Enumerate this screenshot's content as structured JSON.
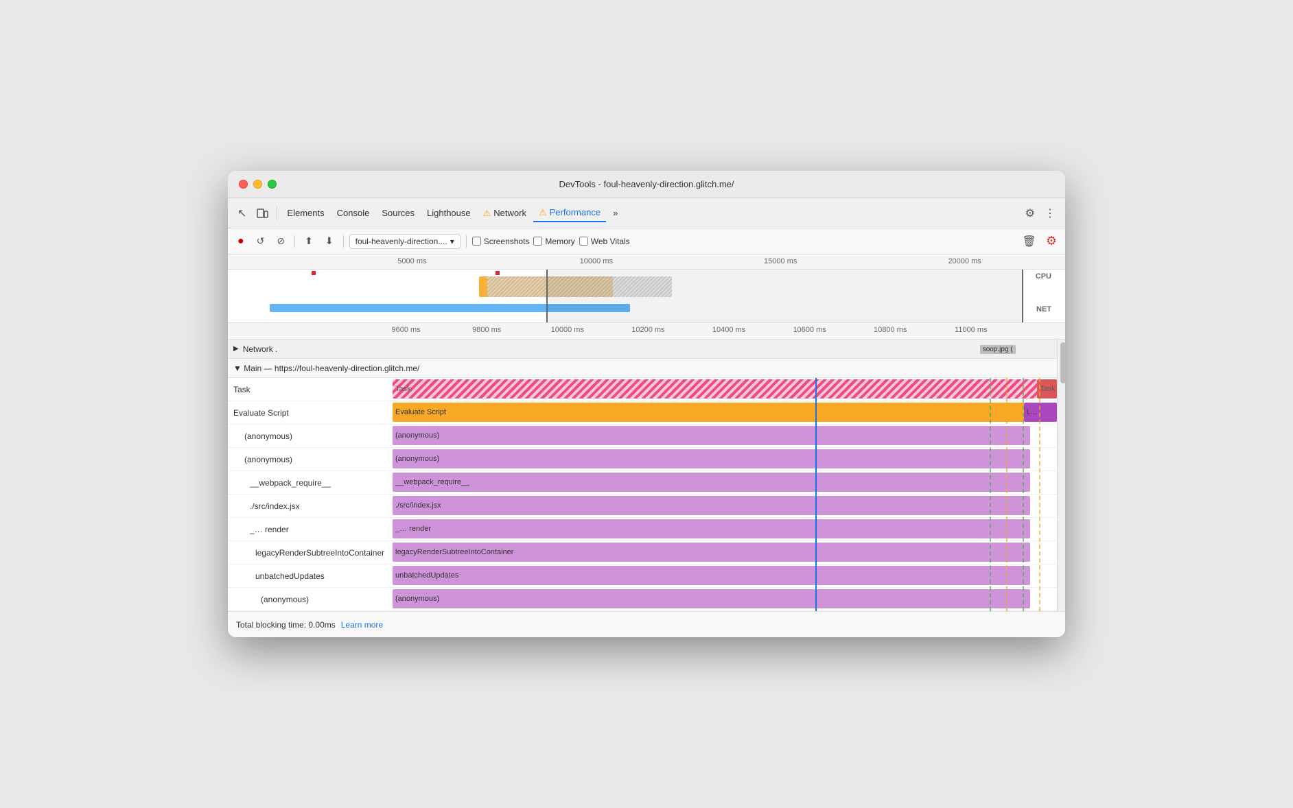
{
  "window": {
    "title": "DevTools - foul-heavenly-direction.glitch.me/"
  },
  "toolbar": {
    "tabs": [
      {
        "id": "elements",
        "label": "Elements",
        "active": false
      },
      {
        "id": "console",
        "label": "Console",
        "active": false
      },
      {
        "id": "sources",
        "label": "Sources",
        "active": false
      },
      {
        "id": "lighthouse",
        "label": "Lighthouse",
        "active": false
      },
      {
        "id": "network",
        "label": "Network",
        "active": false,
        "warning": true
      },
      {
        "id": "performance",
        "label": "Performance",
        "active": true,
        "warning": true
      },
      {
        "id": "more",
        "label": "»",
        "active": false
      }
    ]
  },
  "recording_toolbar": {
    "url": "foul-heavenly-direction....",
    "screenshots_label": "Screenshots",
    "memory_label": "Memory",
    "web_vitals_label": "Web Vitals"
  },
  "overview": {
    "ticks": [
      "5000 ms",
      "10000 ms",
      "15000 ms",
      "20000 ms"
    ],
    "cpu_label": "CPU",
    "net_label": "NET"
  },
  "timeline": {
    "ticks": [
      "9600 ms",
      "9800 ms",
      "10000 ms",
      "10200 ms",
      "10400 ms",
      "10600 ms",
      "10800 ms",
      "11000 ms"
    ],
    "network_section_label": "Network .",
    "soop_label": "soop.jpg (",
    "main_section_label": "▼ Main — https://foul-heavenly-direction.glitch.me/"
  },
  "flame_chart": {
    "rows": [
      {
        "label": "Task",
        "type": "task",
        "color_class": "bar-task",
        "extra_label": "Task"
      },
      {
        "label": "Evaluate Script",
        "type": "evaluate",
        "color_class": "bar-evaluate",
        "extra_label": "L..."
      },
      {
        "label": "(anonymous)",
        "type": "anon",
        "color_class": "bar-anon"
      },
      {
        "label": "(anonymous)",
        "type": "anon",
        "color_class": "bar-anon"
      },
      {
        "label": "__webpack_require__",
        "type": "anon",
        "color_class": "bar-anon"
      },
      {
        "label": "./src/index.jsx",
        "type": "anon",
        "color_class": "bar-anon"
      },
      {
        "label": "_…   render",
        "type": "anon",
        "color_class": "bar-anon"
      },
      {
        "label": "legacyRenderSubtreeIntoContainer",
        "type": "anon",
        "color_class": "bar-anon"
      },
      {
        "label": "unbatchedUpdates",
        "type": "anon",
        "color_class": "bar-anon"
      },
      {
        "label": "(anonymous)",
        "type": "anon",
        "color_class": "bar-anon"
      }
    ]
  },
  "bottom_bar": {
    "blocking_time_text": "Total blocking time: 0.00ms",
    "learn_more_label": "Learn more"
  },
  "icons": {
    "cursor": "↖",
    "device": "⬜",
    "record": "●",
    "reload": "↺",
    "clear": "⊘",
    "import": "⬆",
    "export": "⬇",
    "gear": "⚙",
    "more_vert": "⋮",
    "trash": "🗑",
    "settings_red": "⚙",
    "triangle_right": "▶",
    "triangle_down": "▼"
  },
  "colors": {
    "active_tab": "#1a73e8",
    "task_bg": "#e91e63",
    "evaluate_bg": "#f9a825",
    "anon_bg": "#ce93d8",
    "network_bg": "#64b5f6",
    "warning_yellow": "#f5a623"
  }
}
